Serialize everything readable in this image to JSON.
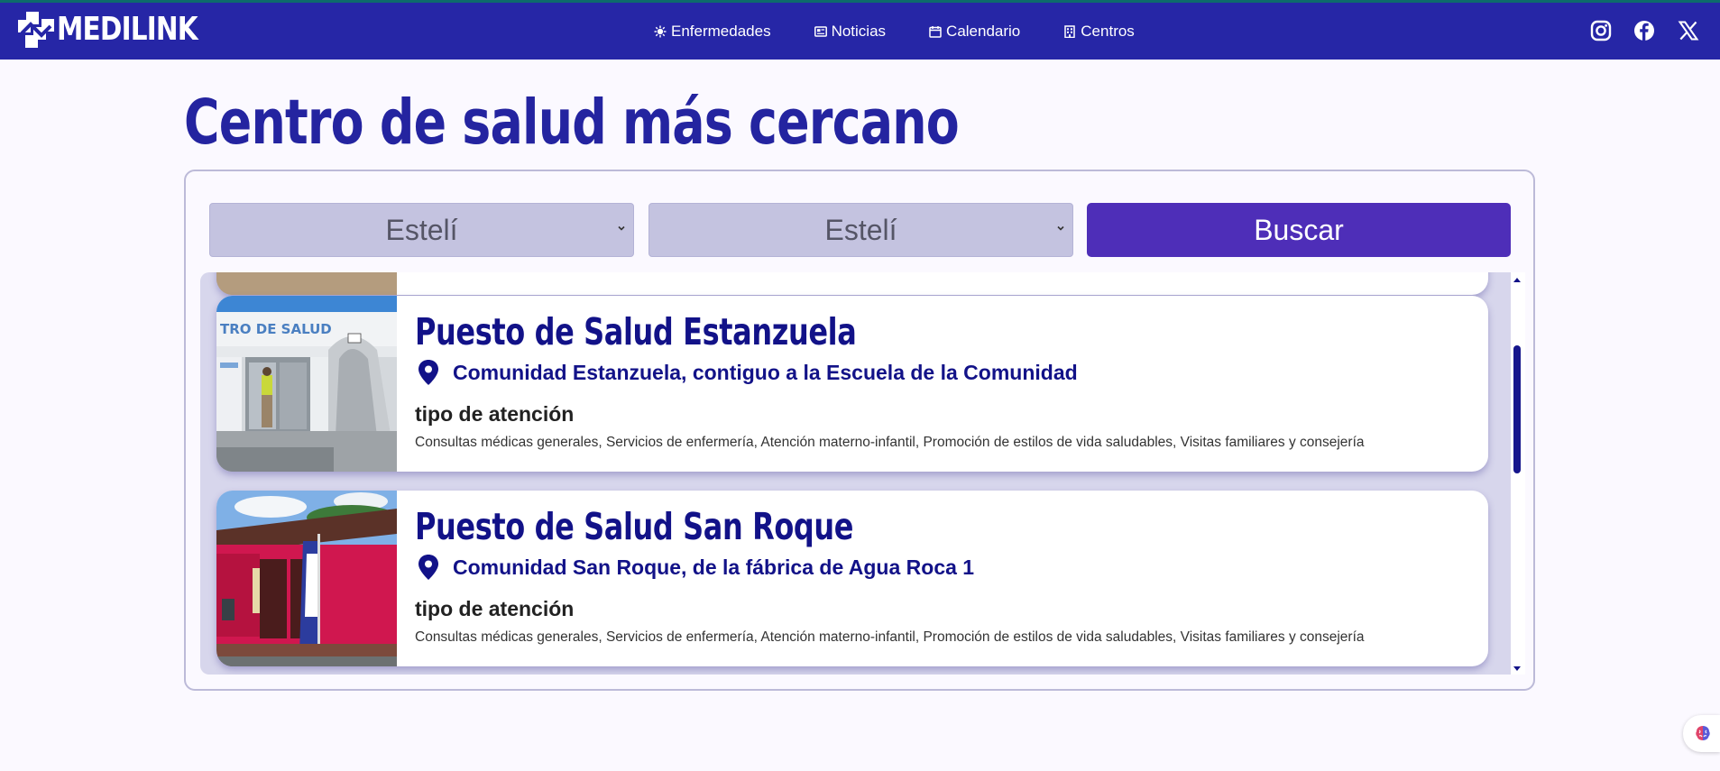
{
  "brand": {
    "name": "MEDILINK",
    "logo_icon": "medilink-logo-icon"
  },
  "nav": {
    "items": [
      {
        "label": "Enfermedades",
        "icon": "virus-icon"
      },
      {
        "label": "Noticias",
        "icon": "newspaper-icon"
      },
      {
        "label": "Calendario",
        "icon": "calendar-icon"
      },
      {
        "label": "Centros",
        "icon": "building-icon"
      }
    ],
    "social": [
      "instagram-icon",
      "facebook-icon",
      "x-icon"
    ]
  },
  "page": {
    "title": "Centro de salud más cercano"
  },
  "filters": {
    "department_selected": "Estelí",
    "municipality_selected": "Estelí",
    "search_label": "Buscar"
  },
  "centers": [
    {
      "name": "Puesto de Salud Estanzuela",
      "address": "Comunidad Estanzuela, contiguo a la Escuela de la Comunidad",
      "care_label": "tipo de atención",
      "services": "Consultas médicas generales, Servicios de enfermería, Atención materno-infantil, Promoción de estilos de vida saludables, Visitas familiares y consejería"
    },
    {
      "name": "Puesto de Salud San Roque",
      "address": "Comunidad San Roque, de la fábrica de Agua Roca 1",
      "care_label": "tipo de atención",
      "services": "Consultas médicas generales, Servicios de enfermería, Atención materno-infantil, Promoción de estilos de vida saludables, Visitas familiares y consejería"
    }
  ],
  "colors": {
    "navbar": "#2626a6",
    "title": "#2424a0",
    "button": "#4e2eb8",
    "select": "#c4c3e0",
    "card_text": "#121288"
  }
}
